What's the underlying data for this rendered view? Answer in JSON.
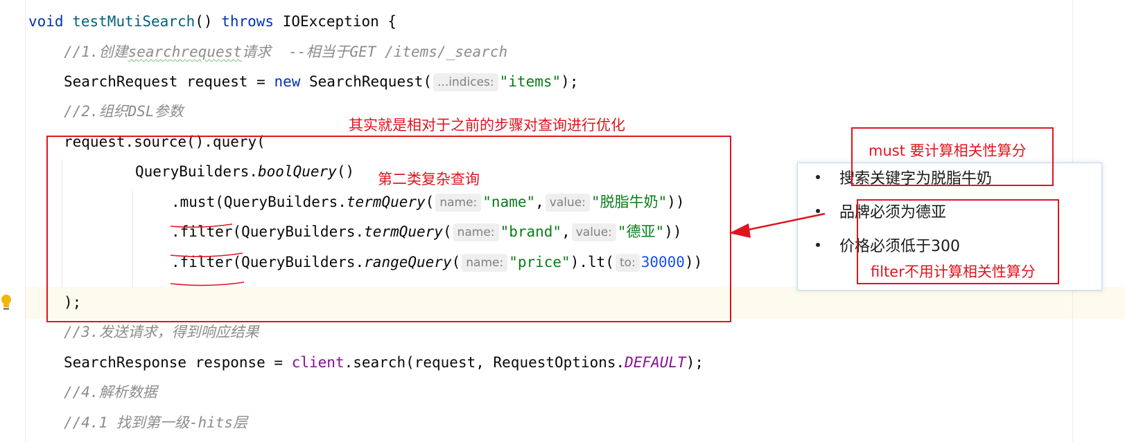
{
  "editor": {
    "line1": {
      "kw_void": "void",
      "method": "testMutiSearch",
      "parens": "() ",
      "kw_throws": "throws",
      "rest": " IOException {"
    },
    "comment1": {
      "prefix": "//1.创建",
      "squiggle": "searchrequest",
      "suffix": "请求  --相当于GET /items/_search"
    },
    "line3": {
      "part1": "SearchRequest request = ",
      "kw_new": "new",
      "part2": " SearchRequest(",
      "hint": "...indices:",
      "str": "\"items\"",
      "end": ");"
    },
    "comment2": "//2.组织DSL参数",
    "line5": "request.source().query(",
    "line6": {
      "part1": "QueryBuilders.",
      "method": "boolQuery",
      "end": "()"
    },
    "line7": {
      "part1": ".must(QueryBuilders.",
      "method": "termQuery",
      "open": "(",
      "hint1": "name:",
      "str1": "\"name\"",
      "comma": ",",
      "hint2": "value:",
      "str2": "\"脱脂牛奶\"",
      "end": "))"
    },
    "line8": {
      "part1": ".filter(QueryBuilders.",
      "method": "termQuery",
      "open": "(",
      "hint1": "name:",
      "str1": "\"brand\"",
      "comma": ",",
      "hint2": "value:",
      "str2": "\"德亚\"",
      "end": "))"
    },
    "line9": {
      "part1": ".filter(QueryBuilders.",
      "method": "rangeQuery",
      "open": "(",
      "hint1": "name:",
      "str1": "\"price\"",
      "mid": ").lt(",
      "hint2": "to:",
      "num": "30000",
      "end": "))"
    },
    "line10": ");",
    "comment3": "//3.发送请求，得到响应结果",
    "line12": {
      "part1": "SearchResponse response = ",
      "field": "client",
      "part2": ".search(request, RequestOptions.",
      "const": "DEFAULT",
      "end": ");"
    },
    "comment4": "//4.解析数据",
    "comment5": "//4.1 找到第一级-hits层"
  },
  "annotations": {
    "top_note": "其实就是相对于之前的步骤对查询进行优化",
    "bool_note": "第二类复杂查询",
    "must_note": "must 要计算相关性算分",
    "filter_note": "filter不用计算相关性算分"
  },
  "popup": {
    "items": [
      "搜索关键字为脱脂牛奶",
      "品牌必须为德亚",
      "价格必须低于300"
    ]
  },
  "colors": {
    "annotation_red": "#e0141e",
    "keyword": "#0033b3",
    "string": "#067d17",
    "number": "#1750eb",
    "comment": "#8c8c8c"
  }
}
